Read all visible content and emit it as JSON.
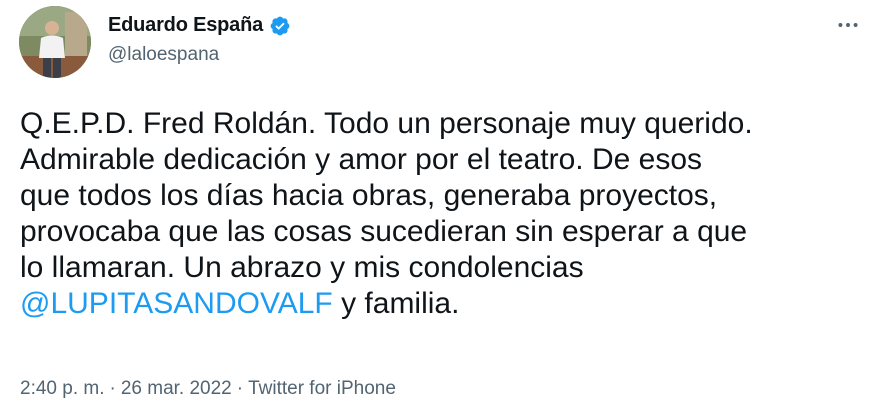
{
  "author": {
    "name": "Eduardo España",
    "handle": "@laloespana",
    "verified": true
  },
  "tweet": {
    "text_before_mention": "Q.E.P.D. Fred Roldán. Todo un personaje muy querido.\nAdmirable dedicación y amor por el teatro. De esos\nque todos los días hacia obras, generaba proyectos,\nprovocaba que las cosas sucedieran sin esperar a que\nlo llamaran. Un abrazo y mis condolencias\n",
    "mention": "@LUPITASANDOVALF",
    "text_after_mention": " y familia."
  },
  "meta": {
    "time": "2:40 p. m.",
    "separator": "·",
    "date": "26 mar. 2022",
    "source": "Twitter for iPhone"
  },
  "icons": {
    "verified": "verified-badge-icon",
    "more": "more-options-icon"
  },
  "colors": {
    "link": "#1d9bf0",
    "text": "#0f1419",
    "secondary": "#536471",
    "verified": "#1d9bf0"
  }
}
